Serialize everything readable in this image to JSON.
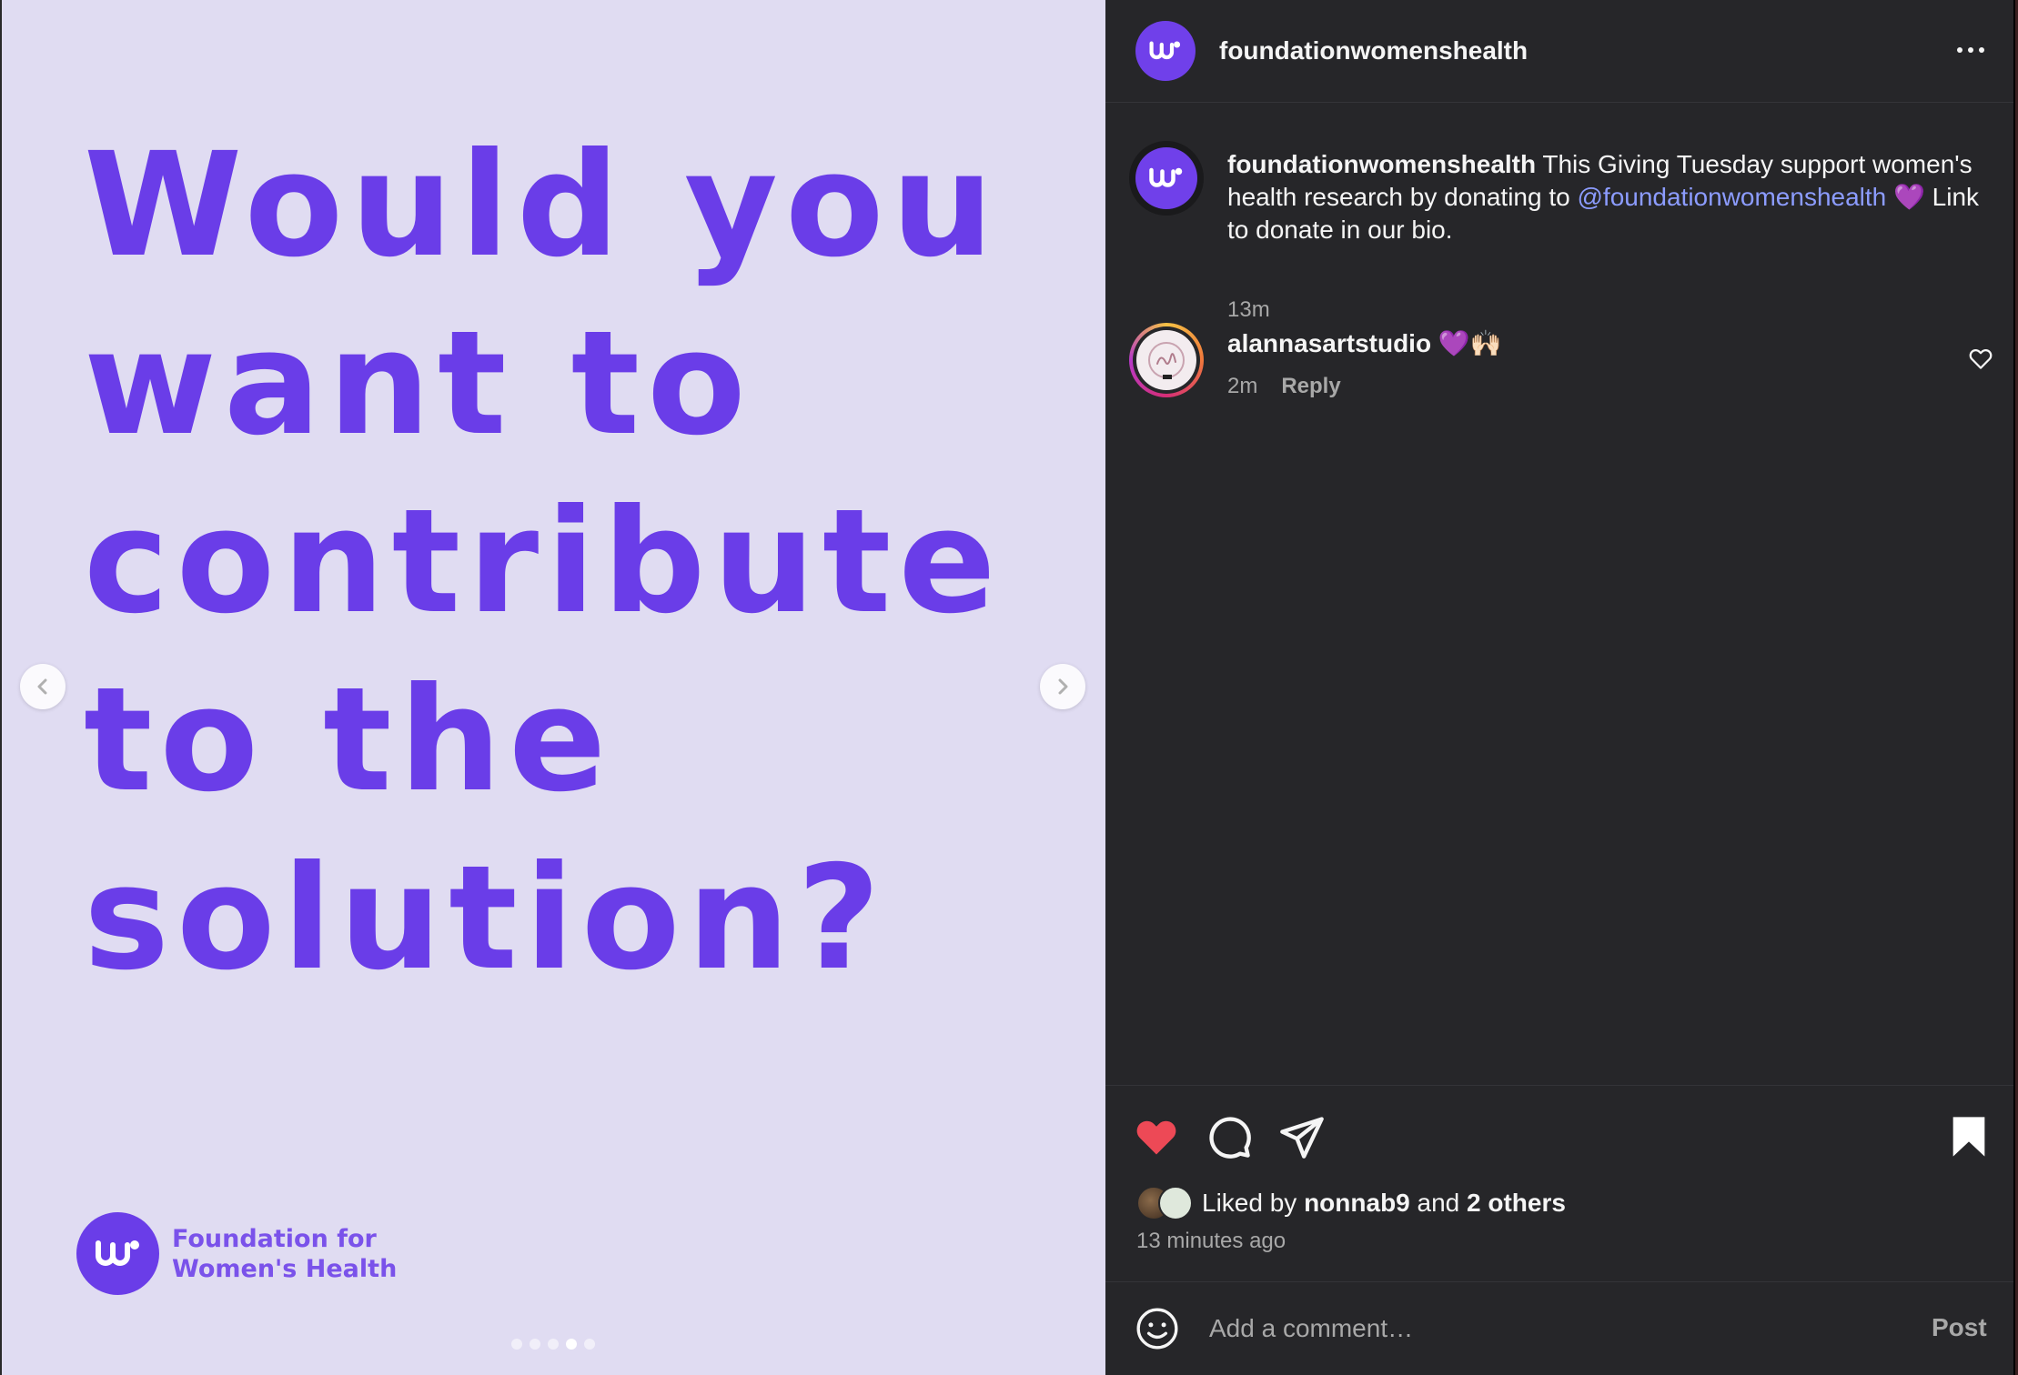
{
  "post": {
    "account": "foundationwomenshealth",
    "slide": {
      "headline_lines": [
        "Would you",
        "want to",
        "contribute",
        "to the",
        "solution?"
      ],
      "brand_lines": [
        "Foundation for",
        "Women's Health"
      ],
      "current_slide": 4,
      "total_slides": 5
    }
  },
  "header": {
    "username": "foundationwomenshealth",
    "more_icon": "more-horizontal-icon"
  },
  "caption": {
    "username": "foundationwomenshealth",
    "text_before": " This Giving Tuesday support women's health research by donating to ",
    "mention": "@foundationwomenshealth",
    "text_after": " 💜 Link to donate in our bio.",
    "time": "13m"
  },
  "comment": {
    "username": "alannasartstudio",
    "text": " 💜🙌🏻",
    "time": "2m",
    "reply_label": "Reply"
  },
  "actions": {
    "liked": true,
    "saved": true,
    "like_icon": "heart-filled-icon",
    "comment_icon": "comment-icon",
    "share_icon": "send-icon",
    "save_icon": "bookmark-filled-icon"
  },
  "likes": {
    "prefix": "Liked by ",
    "first_liker": "nonnab9",
    "joiner": " and ",
    "others": "2 others",
    "time_ago": "13 minutes ago"
  },
  "compose": {
    "placeholder": "Add a comment…",
    "post_label": "Post",
    "emoji_icon": "emoji-icon"
  },
  "colors": {
    "brand_purple": "#6a3de8",
    "slide_bg": "#e0dcf2",
    "panel_bg": "#262629",
    "like_red": "#ed4956",
    "mention_blue": "#8c9cff"
  }
}
